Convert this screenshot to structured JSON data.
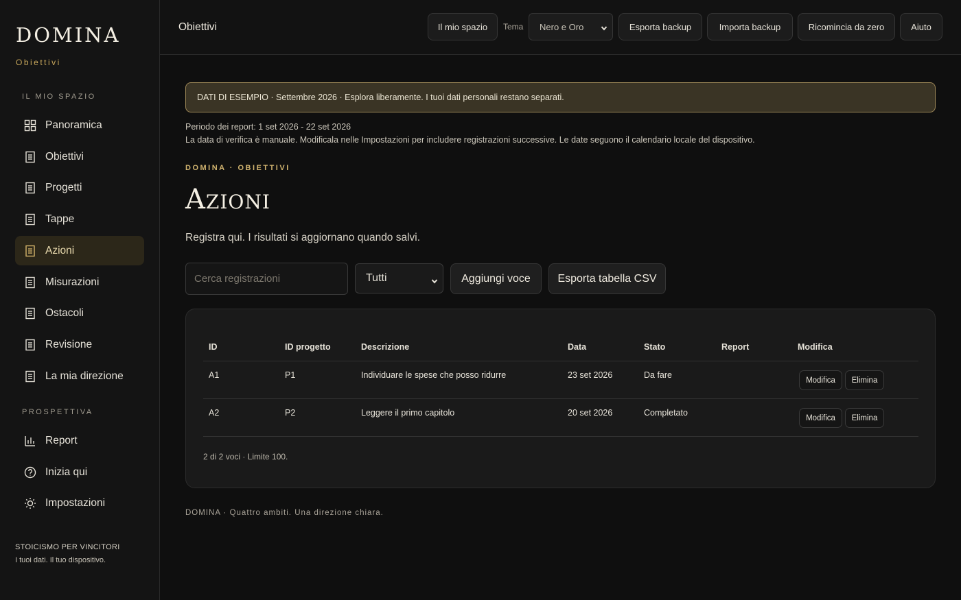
{
  "brand": {
    "name": "DOMINA",
    "subtitle": "Obiettivi"
  },
  "sidebar": {
    "section1": "IL MIO SPAZIO",
    "items": [
      {
        "label": "Panoramica",
        "icon": "grid-icon"
      },
      {
        "label": "Obiettivi",
        "icon": "document-icon"
      },
      {
        "label": "Progetti",
        "icon": "document-icon"
      },
      {
        "label": "Tappe",
        "icon": "document-icon"
      },
      {
        "label": "Azioni",
        "icon": "document-icon",
        "active": true
      },
      {
        "label": "Misurazioni",
        "icon": "document-icon"
      },
      {
        "label": "Ostacoli",
        "icon": "document-icon"
      },
      {
        "label": "Revisione",
        "icon": "document-icon"
      },
      {
        "label": "La mia direzione",
        "icon": "document-icon"
      }
    ],
    "section2": "PROSPETTIVA",
    "items2": [
      {
        "label": "Report",
        "icon": "bar-chart-icon"
      },
      {
        "label": "Inizia qui",
        "icon": "help-circle-icon"
      },
      {
        "label": "Impostazioni",
        "icon": "sun-icon"
      }
    ],
    "footer_line1": "STOICISMO PER VINCITORI",
    "footer_line2": "I tuoi dati. Il tuo dispositivo."
  },
  "topbar": {
    "title": "Obiettivi",
    "my_space": "Il mio spazio",
    "theme_label": "Tema",
    "theme_value": "Nero e Oro",
    "export_backup": "Esporta backup",
    "import_backup": "Importa backup",
    "reset": "Ricomincia da zero",
    "help": "Aiuto"
  },
  "banner": "DATI DI ESEMPIO · Settembre 2026 · Esplora liberamente. I tuoi dati personali restano separati.",
  "period": "Periodo dei report: 1 set 2026 - 22 set 2026",
  "note": "La data di verifica è manuale. Modificala nelle Impostazioni per includere registrazioni successive. Le date seguono il calendario locale del dispositivo.",
  "eyebrow": "DOMINA · OBIETTIVI",
  "title": "Azioni",
  "lead": "Registra qui. I risultati si aggiornano quando salvi.",
  "controls": {
    "search_placeholder": "Cerca registrazioni",
    "filter_value": "Tutti",
    "add_label": "Aggiungi voce",
    "export_csv_label": "Esporta tabella CSV"
  },
  "table": {
    "headers": [
      "ID",
      "ID progetto",
      "Descrizione",
      "Data",
      "Stato",
      "Report",
      "Modifica"
    ],
    "rows": [
      {
        "id": "A1",
        "project": "P1",
        "description": "Individuare le spese che posso ridurre",
        "date": "23 set 2026",
        "status": "Da fare",
        "report": ""
      },
      {
        "id": "A2",
        "project": "P2",
        "description": "Leggere il primo capitolo",
        "date": "20 set 2026",
        "status": "Completato",
        "report": ""
      }
    ],
    "edit_label": "Modifica",
    "delete_label": "Elimina",
    "summary": "2 di 2 voci · Limite 100."
  },
  "footer": "DOMINA · Quattro ambiti. Una direzione chiara.",
  "colors": {
    "accent": "#d4b46a",
    "background": "#0f0f0f",
    "banner": "#3a3425"
  }
}
